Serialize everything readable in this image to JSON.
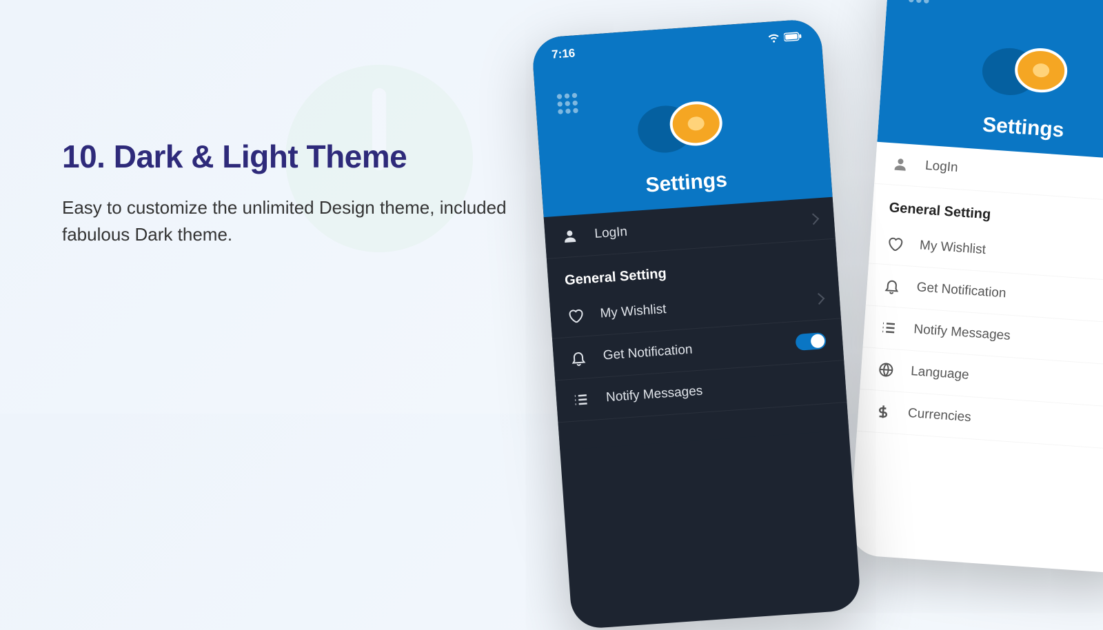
{
  "heading": "10. Dark & Light Theme",
  "description": "Easy to customize the unlimited Design theme, included fabulous Dark theme.",
  "dark": {
    "time": "7:16",
    "title": "Settings",
    "login": "LogIn",
    "section": "General Setting",
    "items": [
      {
        "label": "My Wishlist",
        "icon": "heart"
      },
      {
        "label": "Get Notification",
        "icon": "bell"
      },
      {
        "label": "Notify Messages",
        "icon": "list"
      }
    ]
  },
  "light": {
    "title": "Settings",
    "login": "LogIn",
    "section": "General Setting",
    "items": [
      {
        "label": "My Wishlist",
        "icon": "heart"
      },
      {
        "label": "Get Notification",
        "icon": "bell"
      },
      {
        "label": "Notify Messages",
        "icon": "list"
      },
      {
        "label": "Language",
        "icon": "globe"
      },
      {
        "label": "Currencies",
        "icon": "dollar"
      }
    ]
  }
}
